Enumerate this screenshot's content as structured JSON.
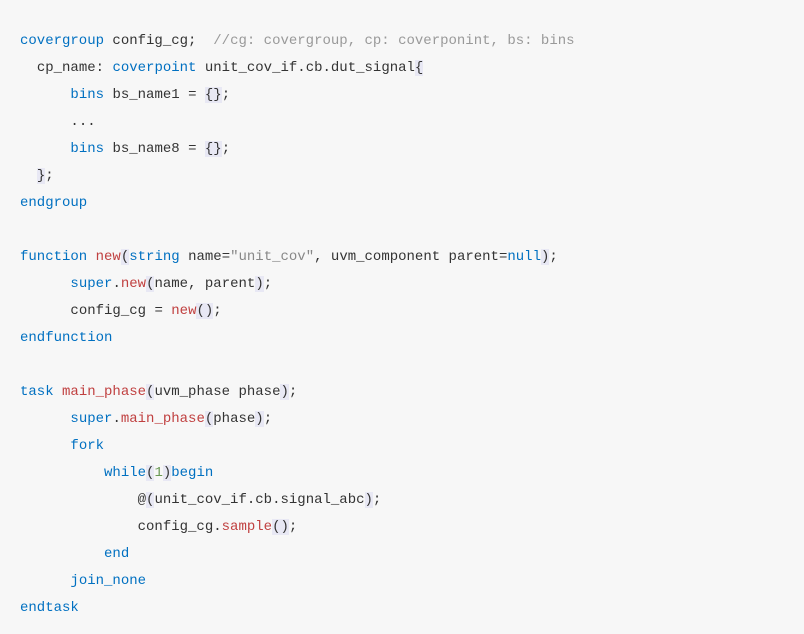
{
  "code": {
    "line1": {
      "kw_covergroup": "covergroup",
      "name": "config_cg",
      "semi": ";",
      "comment": "//cg: covergroup, cp: coverponint, bs: bins"
    },
    "line2": {
      "cp_label": "cp_name",
      "colon": ":",
      "kw_coverpoint": "coverpoint",
      "expr1": "unit_cov_if",
      "dot1": ".",
      "expr2": "cb",
      "dot2": ".",
      "expr3": "dut_signal",
      "brace": "{"
    },
    "line3": {
      "kw_bins": "bins",
      "name": "bs_name1",
      "eq": "=",
      "braces": "{}",
      "semi": ";"
    },
    "line4": {
      "ellipsis": "..."
    },
    "line5": {
      "kw_bins": "bins",
      "name": "bs_name8",
      "eq": "=",
      "braces": "{}",
      "semi": ";"
    },
    "line6": {
      "brace": "}",
      "semi": ";"
    },
    "line7": {
      "kw": "endgroup"
    },
    "line9": {
      "kw_function": "function",
      "kw_new": "new",
      "lparen": "(",
      "kw_string": "string",
      "name_lbl": "name",
      "eq1": "=",
      "str": "\"unit_cov\"",
      "comma": ",",
      "uvm_comp": "uvm_component",
      "parent_lbl": "parent",
      "eq2": "=",
      "kw_null": "null",
      "rparen": ")",
      "semi": ";"
    },
    "line10": {
      "kw_super": "super",
      "dot": ".",
      "kw_new": "new",
      "lparen": "(",
      "arg1": "name",
      "comma": ",",
      "arg2": "parent",
      "rparen": ")",
      "semi": ";"
    },
    "line11": {
      "name": "config_cg",
      "eq": "=",
      "kw_new": "new",
      "parens": "()",
      "semi": ";"
    },
    "line12": {
      "kw": "endfunction"
    },
    "line14": {
      "kw_task": "task",
      "name": "main_phase",
      "lparen": "(",
      "type": "uvm_phase",
      "arg": "phase",
      "rparen": ")",
      "semi": ";"
    },
    "line15": {
      "kw_super": "super",
      "dot": ".",
      "method": "main_phase",
      "lparen": "(",
      "arg": "phase",
      "rparen": ")",
      "semi": ";"
    },
    "line16": {
      "kw": "fork"
    },
    "line17": {
      "kw_while": "while",
      "lparen": "(",
      "one": "1",
      "rparen": ")",
      "kw_begin": "begin"
    },
    "line18": {
      "at": "@",
      "lparen": "(",
      "p1": "unit_cov_if",
      "dot1": ".",
      "p2": "cb",
      "dot2": ".",
      "p3": "signal_abc",
      "rparen": ")",
      "semi": ";"
    },
    "line19": {
      "name": "config_cg",
      "dot": ".",
      "method": "sample",
      "parens": "()",
      "semi": ";"
    },
    "line20": {
      "kw": "end"
    },
    "line21": {
      "kw": "join_none"
    },
    "line22": {
      "kw": "endtask"
    }
  }
}
